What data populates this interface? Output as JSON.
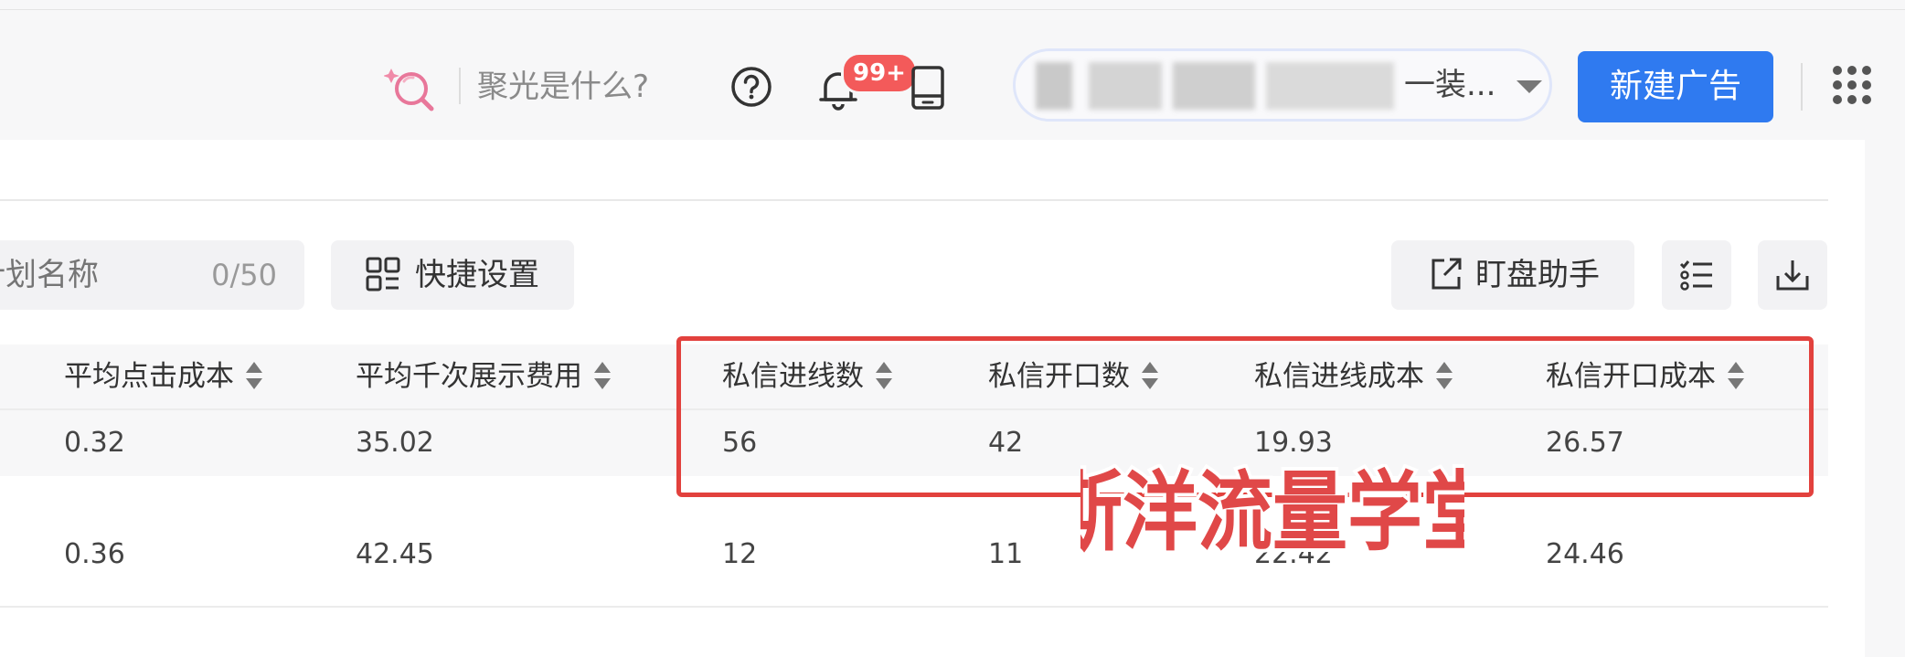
{
  "header": {
    "spotlight_question": "聚光是什么?",
    "notification_badge": "99+",
    "account_selector_text": "一装...",
    "new_ad_button": "新建广告",
    "icons": [
      "spotlight-search-icon",
      "help-icon",
      "bell-icon",
      "tablet-icon",
      "apps-grid-icon"
    ]
  },
  "toolbar": {
    "plan_name_placeholder": "计划名称",
    "plan_name_counter": "0/50",
    "quick_settings_label": "快捷设置",
    "monitor_assistant_label": "盯盘助手",
    "icons": [
      "quick-settings-icon",
      "external-link-icon",
      "column-settings-icon",
      "download-icon"
    ]
  },
  "table": {
    "columns": [
      "平均点击成本",
      "平均千次展示费用",
      "私信进线数",
      "私信开口数",
      "私信进线成本",
      "私信开口成本"
    ],
    "rows": [
      [
        "0.32",
        "35.02",
        "56",
        "42",
        "19.93",
        "26.57"
      ],
      [
        "0.36",
        "42.45",
        "12",
        "11",
        "22.42",
        "24.46"
      ]
    ]
  },
  "watermark_text": "斯洋流量学堂",
  "colors": {
    "primary": "#2f7af0",
    "badge": "#f35a5a",
    "highlight_border": "#e2413d",
    "watermark": "#e04848"
  }
}
